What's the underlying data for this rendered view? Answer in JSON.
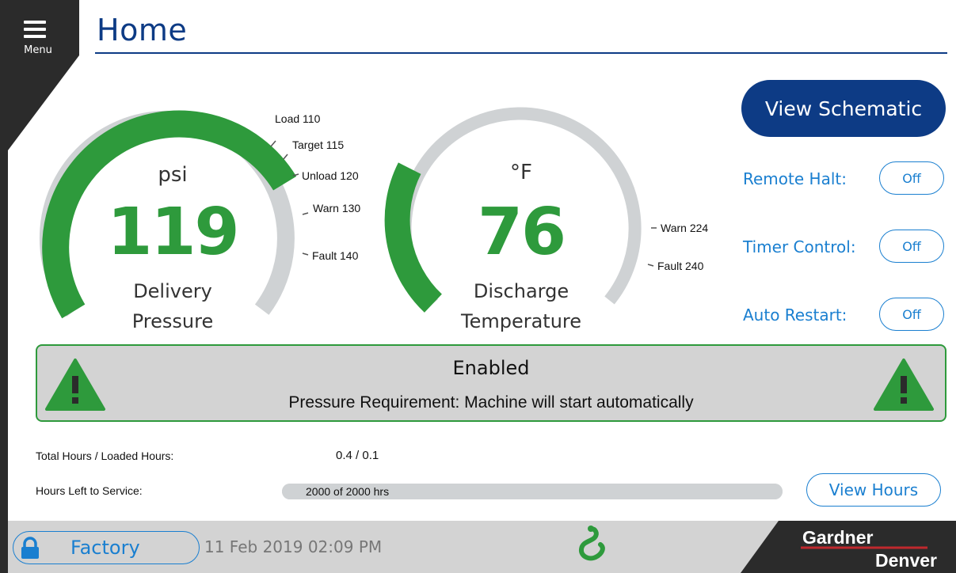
{
  "header": {
    "menu_label": "Menu",
    "title": "Home"
  },
  "gauges": [
    {
      "unit": "psi",
      "value": "119",
      "caption_line1": "Delivery",
      "caption_line2": "Pressure",
      "accent_color": "#2e9a3c",
      "ticks": [
        "Load 110",
        "Target 115",
        "Unload 120",
        "Warn 130",
        "Fault 140"
      ]
    },
    {
      "unit": "°F",
      "value": "76",
      "caption_line1": "Discharge",
      "caption_line2": "Temperature",
      "accent_color": "#2e9a3c",
      "ticks": [
        "Warn 224",
        "Fault 240"
      ]
    }
  ],
  "controls": {
    "view_schematic_label": "View Schematic",
    "remote_halt": {
      "label": "Remote Halt:",
      "state": "Off"
    },
    "timer_control": {
      "label": "Timer Control:",
      "state": "Off"
    },
    "auto_restart": {
      "label": "Auto Restart:",
      "state": "Off"
    }
  },
  "status": {
    "title": "Enabled",
    "message": "Pressure Requirement: Machine will start automatically",
    "icon": "warning-triangle-icon",
    "color": "#2e9a3c"
  },
  "hours": {
    "total_label": "Total Hours / Loaded Hours:",
    "total_value": "0.4  / 0.1",
    "service_label": "Hours Left to Service:",
    "service_text": "2000 of 2000 hrs",
    "service_fraction": 1.0,
    "view_hours_label": "View Hours"
  },
  "footer": {
    "user_label": "Factory",
    "datetime": "11 Feb 2019  02:09 PM",
    "brand_line1": "Gardner",
    "brand_line2": "Denver"
  },
  "colors": {
    "navy": "#0d3b85",
    "link_blue": "#1a7fd0",
    "green": "#2e9a3c",
    "gray": "#d3d3d3"
  }
}
